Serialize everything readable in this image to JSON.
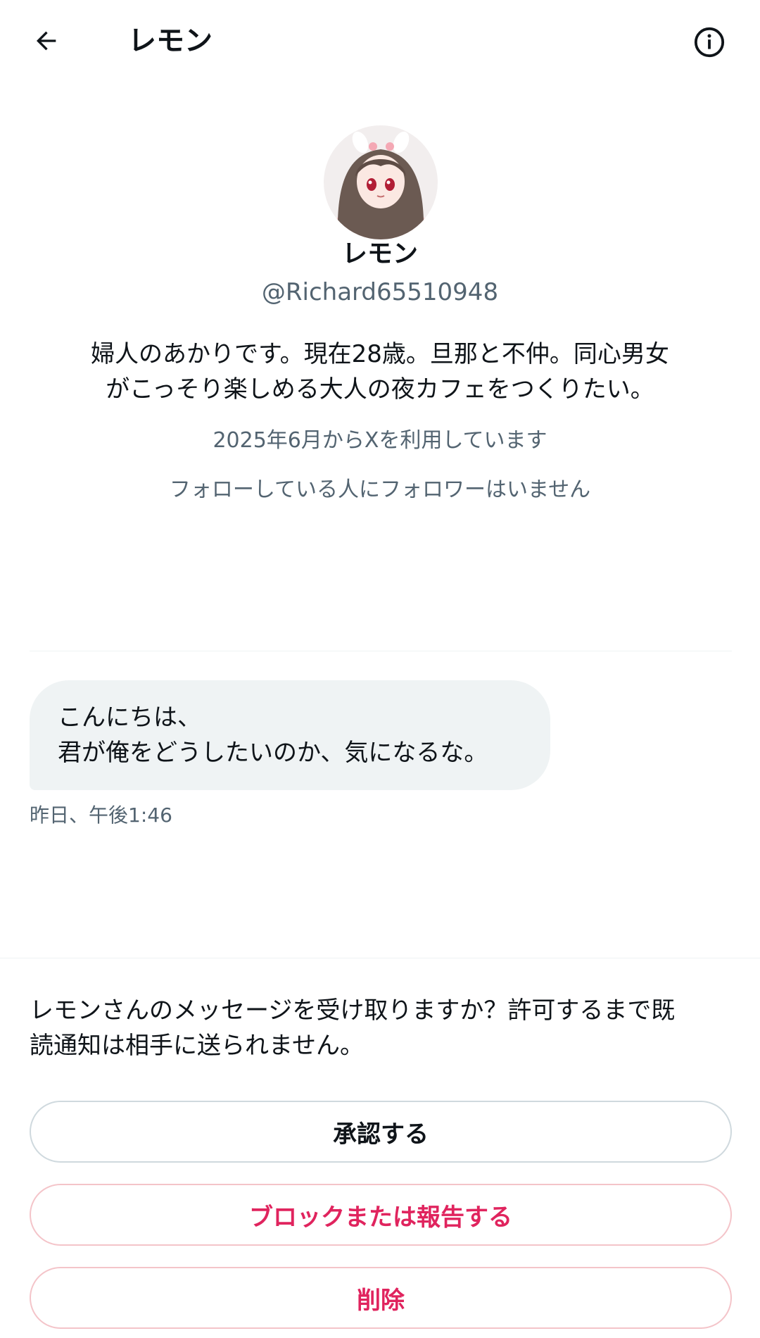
{
  "header": {
    "title": "レモン",
    "back_icon": "arrow-left-icon",
    "info_icon": "info-circle-icon"
  },
  "profile": {
    "name": "レモン",
    "handle": "@Richard65510948",
    "bio_line1": "婦人のあかりです。現在28歳。旦那と不仲。同心男女",
    "bio_line2": "がこっそり楽しめる大人の夜カフェをつくりたい。",
    "joined": "2025年6月からXを利用しています",
    "followers_note": "フォローしている人にフォロワーはいません"
  },
  "message": {
    "line1": "こんにちは、",
    "line2": "君が俺をどうしたいのか、気になるな。",
    "timestamp": "昨日、午後1:46"
  },
  "request": {
    "line1": "レモンさんのメッセージを受け取りますか？許可するまで既",
    "line2": "読通知は相手に送られません。",
    "accept_label": "承認する",
    "block_label": "ブロックまたは報告する",
    "delete_label": "削除"
  },
  "colors": {
    "text": "#0f1419",
    "secondary": "#536471",
    "bubble": "#eff3f4",
    "danger": "#e0245e"
  }
}
